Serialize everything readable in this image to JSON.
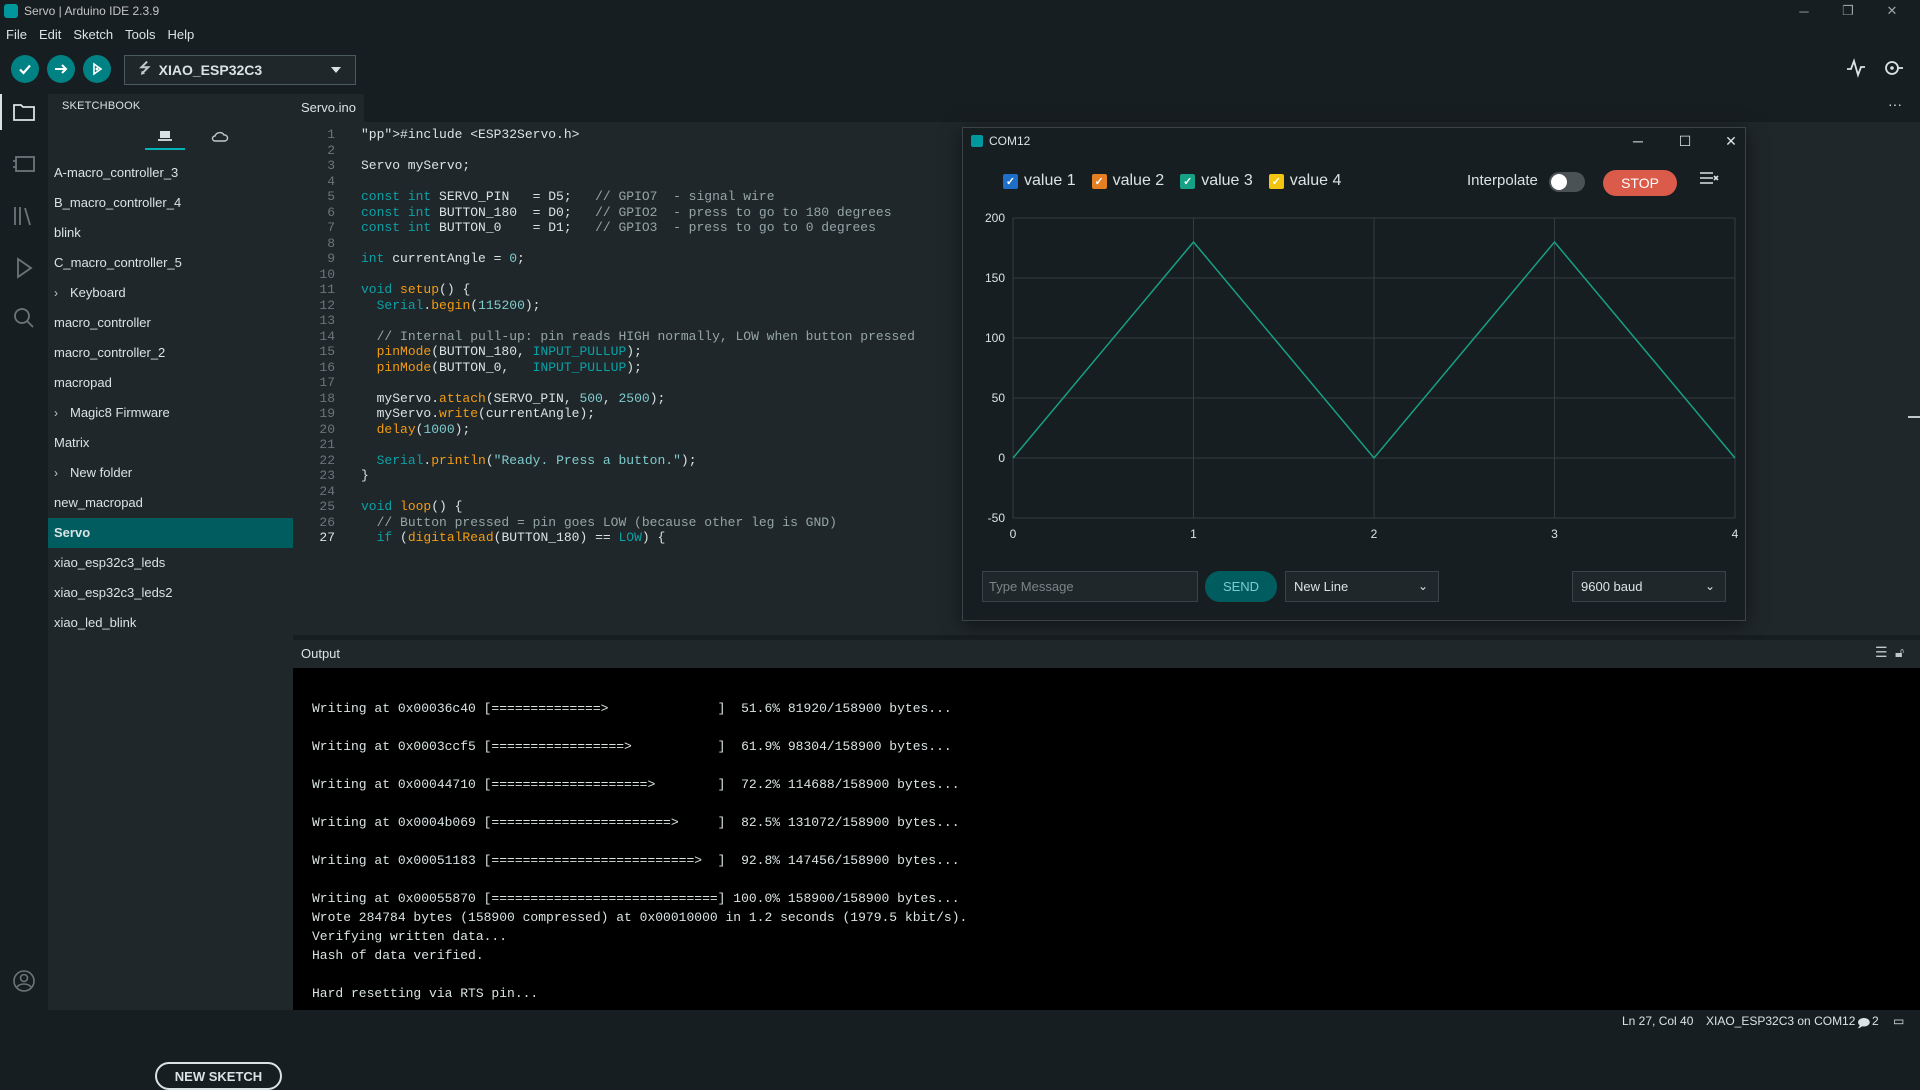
{
  "window": {
    "title": "Servo | Arduino IDE 2.3.9",
    "controls": [
      "─",
      "❐",
      "✕"
    ]
  },
  "menu": [
    "File",
    "Edit",
    "Sketch",
    "Tools",
    "Help"
  ],
  "toolbar": {
    "verify_icon": "check-icon",
    "upload_icon": "arrow-right-icon",
    "debug_icon": "debug-icon",
    "board": "XIAO_ESP32C3",
    "serial_plotter_icon": "plotter-icon",
    "serial_monitor_icon": "monitor-icon"
  },
  "sidebar": {
    "title": "SKETCHBOOK",
    "items": [
      {
        "label": "A-macro_controller_3",
        "folder": false
      },
      {
        "label": "B_macro_controller_4",
        "folder": false
      },
      {
        "label": "blink",
        "folder": false
      },
      {
        "label": "C_macro_controller_5",
        "folder": false
      },
      {
        "label": "Keyboard",
        "folder": true
      },
      {
        "label": "macro_controller",
        "folder": false
      },
      {
        "label": "macro_controller_2",
        "folder": false
      },
      {
        "label": "macropad",
        "folder": false
      },
      {
        "label": "Magic8 Firmware",
        "folder": true
      },
      {
        "label": "Matrix",
        "folder": false
      },
      {
        "label": "New folder",
        "folder": true
      },
      {
        "label": "new_macropad",
        "folder": false
      },
      {
        "label": "Servo",
        "folder": false,
        "selected": true
      },
      {
        "label": "xiao_esp32c3_leds",
        "folder": false
      },
      {
        "label": "xiao_esp32c3_leds2",
        "folder": false
      },
      {
        "label": "xiao_led_blink",
        "folder": false
      }
    ],
    "new_sketch": "NEW SKETCH"
  },
  "editor": {
    "tab": "Servo.ino",
    "current_line": 27,
    "lines": [
      "#include <ESP32Servo.h>",
      "",
      "Servo myServo;",
      "",
      "const int SERVO_PIN   = D5;   // GPIO7  - signal wire",
      "const int BUTTON_180  = D0;   // GPIO2  - press to go to 180 degrees",
      "const int BUTTON_0    = D1;   // GPIO3  - press to go to 0 degrees",
      "",
      "int currentAngle = 0;",
      "",
      "void setup() {",
      "  Serial.begin(115200);",
      "",
      "  // Internal pull-up: pin reads HIGH normally, LOW when button pressed",
      "  pinMode(BUTTON_180, INPUT_PULLUP);",
      "  pinMode(BUTTON_0,   INPUT_PULLUP);",
      "",
      "  myServo.attach(SERVO_PIN, 500, 2500);",
      "  myServo.write(currentAngle);",
      "  delay(1000);",
      "",
      "  Serial.println(\"Ready. Press a button.\");",
      "}",
      "",
      "void loop() {",
      "  // Button pressed = pin goes LOW (because other leg is GND)",
      "  if (digitalRead(BUTTON_180) == LOW) {"
    ]
  },
  "serial_plotter": {
    "title": "COM12",
    "legend": [
      {
        "label": "value 1",
        "color": "#1e6fc7"
      },
      {
        "label": "value 2",
        "color": "#e67e22"
      },
      {
        "label": "value 3",
        "color": "#16a085"
      },
      {
        "label": "value 4",
        "color": "#f1c40f"
      }
    ],
    "interpolate_label": "Interpolate",
    "interpolate_on": false,
    "stop_label": "STOP",
    "message_placeholder": "Type Message",
    "send_label": "SEND",
    "line_ending": "New Line",
    "baud": "9600 baud",
    "chart_data": {
      "type": "line",
      "x": [
        0,
        1,
        2,
        3,
        4
      ],
      "series": [
        {
          "values": [
            0,
            180,
            0,
            180,
            0
          ],
          "color": "#16a085"
        }
      ],
      "xticks": [
        "0",
        "1",
        "2",
        "3",
        "4"
      ],
      "yticks": [
        "200",
        "150",
        "100",
        "50",
        "0",
        "-50"
      ],
      "ylim": [
        -50,
        200
      ],
      "xlim": [
        0,
        4
      ],
      "grid": true
    }
  },
  "output": {
    "title": "Output",
    "lines": [
      "",
      "Writing at 0x00036c40 [==============>              ]  51.6% 81920/158900 bytes...",
      "",
      "Writing at 0x0003ccf5 [=================>           ]  61.9% 98304/158900 bytes...",
      "",
      "Writing at 0x00044710 [====================>        ]  72.2% 114688/158900 bytes...",
      "",
      "Writing at 0x0004b069 [=======================>     ]  82.5% 131072/158900 bytes...",
      "",
      "Writing at 0x00051183 [==========================>  ]  92.8% 147456/158900 bytes...",
      "",
      "Writing at 0x00055870 [=============================] 100.0% 158900/158900 bytes...",
      "Wrote 284784 bytes (158900 compressed) at 0x00010000 in 1.2 seconds (1979.5 kbit/s).",
      "Verifying written data...",
      "Hash of data verified.",
      "",
      "Hard resetting via RTS pin..."
    ]
  },
  "status": {
    "position": "Ln 27, Col 40",
    "board_port": "XIAO_ESP32C3 on COM12",
    "notifications": "2"
  }
}
